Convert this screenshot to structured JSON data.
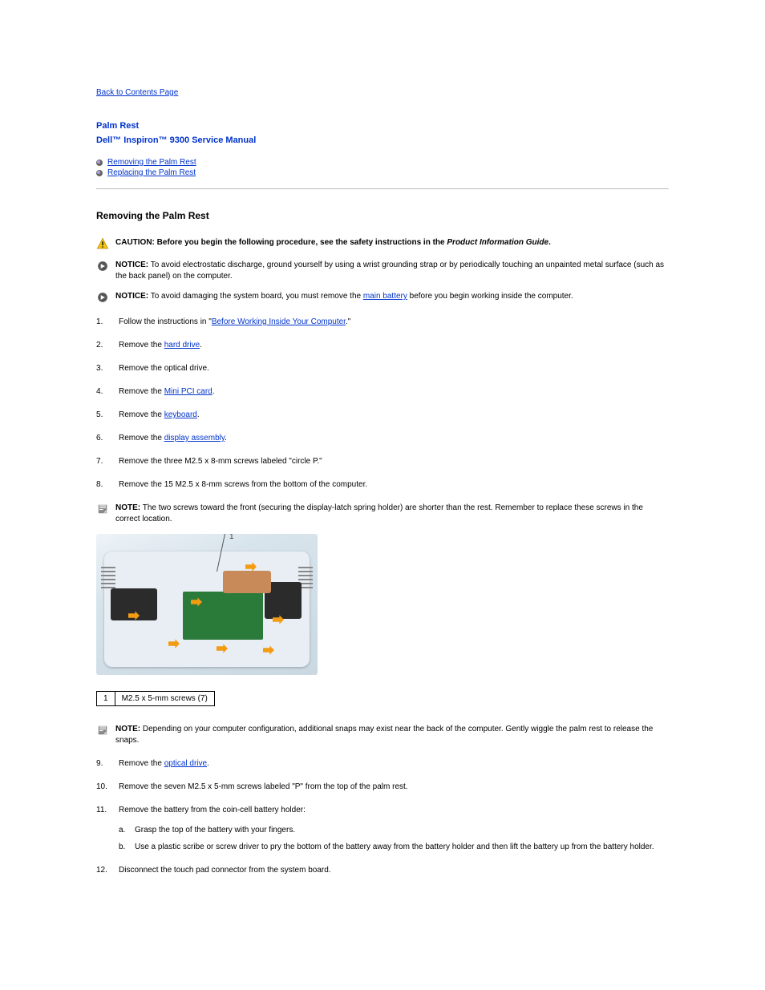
{
  "nav": {
    "back_label": "Back to Contents Page"
  },
  "header": {
    "page_title": "Palm Rest",
    "manual_title": "Dell™ Inspiron™ 9300 Service Manual"
  },
  "toc": {
    "remove_link": "Removing the Palm Rest",
    "replace_link": "Replacing the Palm Rest"
  },
  "section": {
    "remove_heading": "Removing the Palm Rest"
  },
  "caution": {
    "prefix": "CAUTION: Before you begin the following procedure, see the safety instructions in the",
    "emph": "Product Information Guide",
    "suffix": "."
  },
  "notice1": {
    "prefix": "NOTICE:",
    "text": " To avoid electrostatic discharge, ground yourself by using a wrist grounding strap or by periodically touching an unpainted metal surface (such as the back panel) on the computer."
  },
  "notice2": {
    "prefix": "NOTICE:",
    "pre": " To avoid damaging the system board, you must remove the ",
    "link": "main battery",
    "post": " before you begin working inside the computer."
  },
  "steps": {
    "s1_pre": "Follow the instructions in \"",
    "s1_link": "Before Working Inside Your Computer",
    "s1_post": ".\"",
    "s2_pre": "Remove the ",
    "s2_link": "hard drive",
    "s2_post": ".",
    "s3": "Remove the optical drive.",
    "s4_pre": "Remove the ",
    "s4_link": "Mini PCI card",
    "s4_post": ".",
    "s5_pre": "Remove the ",
    "s5_link": "keyboard",
    "s5_post": ".",
    "s6_pre": "Remove the ",
    "s6_link": "display assembly",
    "s6_post": ".",
    "s7": "Remove the three M2.5 x 8-mm screws labeled \"circle P.\"",
    "s8": "Remove the 15 M2.5 x 8-mm screws from the bottom of the computer.",
    "s9_pre": "Remove the ",
    "s9_link": "optical drive",
    "s9_post": ".",
    "s10": "Remove the seven M2.5 x 5-mm screws labeled \"P\" from the top of the palm rest.",
    "s11": "Remove the battery from the coin-cell battery holder:",
    "s11a": "Grasp the top of the battery with your fingers.",
    "s11b": "Use a plastic scribe or screw driver to pry the bottom of the battery away from the battery holder and then lift the battery up from the battery holder.",
    "s12": "Disconnect the touch pad connector from the system board."
  },
  "note1": {
    "prefix": "NOTE:",
    "text": " The two screws toward the front (securing the display-latch spring holder) are shorter than the rest. Remember to replace these screws in the correct location."
  },
  "figure": {
    "label1": "1"
  },
  "legend": {
    "num": "1",
    "text": "M2.5 x 5-mm screws (7)"
  },
  "note2": {
    "prefix": "NOTE:",
    "text": " Depending on your computer configuration, additional snaps may exist near the back of the computer. Gently wiggle the palm rest to release the snaps."
  }
}
